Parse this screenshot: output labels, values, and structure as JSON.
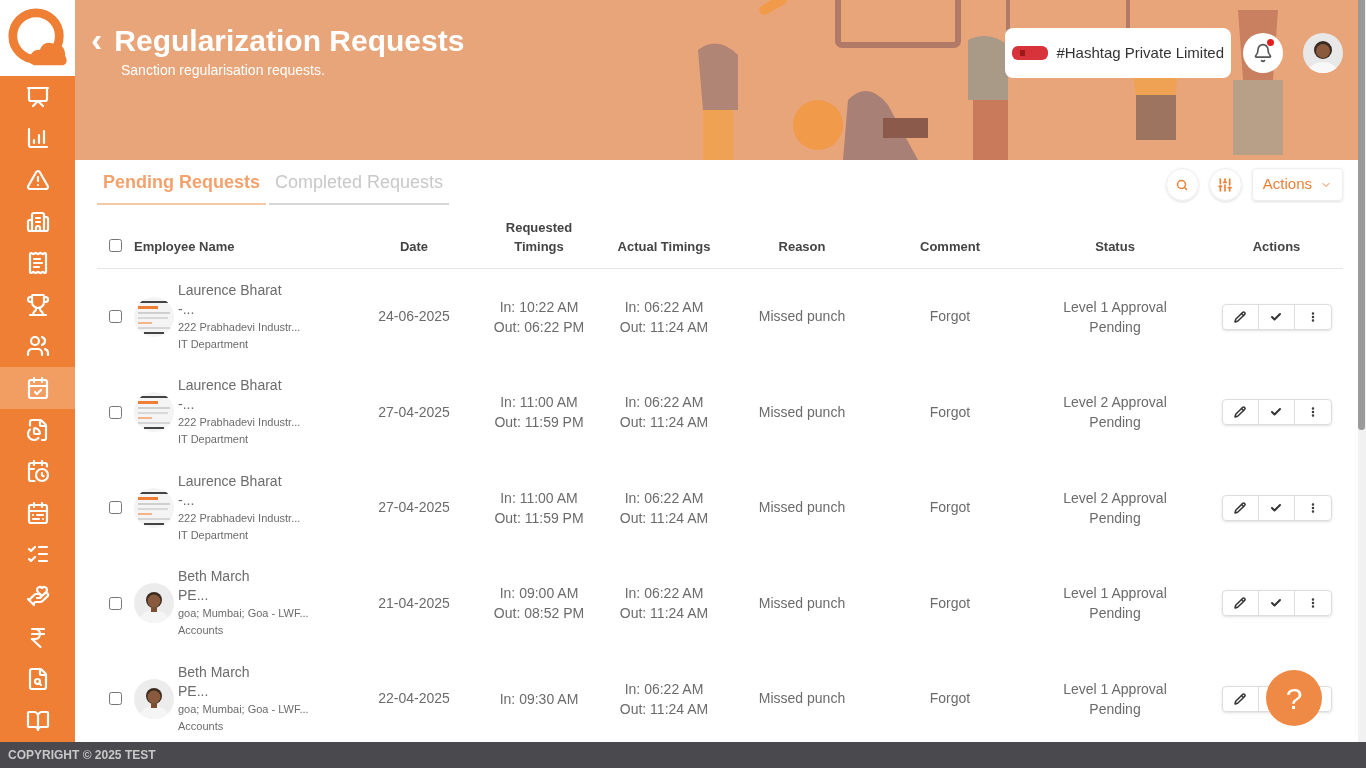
{
  "sidebar": {
    "items": [
      {
        "selected": false
      },
      {
        "selected": false
      },
      {
        "selected": false
      },
      {
        "selected": false
      },
      {
        "selected": false
      },
      {
        "selected": false
      },
      {
        "selected": false
      },
      {
        "selected": true
      },
      {
        "selected": false
      },
      {
        "selected": false
      },
      {
        "selected": false
      },
      {
        "selected": false
      },
      {
        "selected": false
      },
      {
        "selected": false
      },
      {
        "selected": false
      },
      {
        "selected": false
      }
    ]
  },
  "header": {
    "back": "‹",
    "title": "Regularization Requests",
    "subtitle": "Sanction regularisation requests.",
    "company": "#Hashtag Private Limited",
    "notifications": {
      "unread": true
    }
  },
  "tabs": [
    {
      "label": "Pending Requests",
      "selected": true
    },
    {
      "label": "Completed Requests",
      "selected": false
    }
  ],
  "toolbar": {
    "actions_button": "Actions"
  },
  "table": {
    "select_all": {
      "checked": false
    },
    "columns": [
      "Employee Name",
      "Date",
      "Requested Timings",
      "Actual Timings",
      "Reason",
      "Comment",
      "Status",
      "Actions"
    ],
    "rows": [
      {
        "checked": false,
        "avatar": {
          "kind": "document"
        },
        "name": "Laurence Bharat",
        "name_rest": "-...",
        "location": "222 Prabhadevi Industr...",
        "department": "IT Department",
        "date": "24-06-2025",
        "requested": [
          "In: 10:22 AM",
          "Out: 06:22 PM"
        ],
        "actual": [
          "In: 06:22 AM",
          "Out: 11:24 AM"
        ],
        "reason": "Missed punch",
        "comment": "Forgot",
        "status": "Level 1 Approval Pending"
      },
      {
        "checked": false,
        "avatar": {
          "kind": "document"
        },
        "name": "Laurence Bharat",
        "name_rest": "-...",
        "location": "222 Prabhadevi Industr...",
        "department": "IT Department",
        "date": "27-04-2025",
        "requested": [
          "In: 11:00 AM",
          "Out: 11:59 PM"
        ],
        "actual": [
          "In: 06:22 AM",
          "Out: 11:24 AM"
        ],
        "reason": "Missed punch",
        "comment": "Forgot",
        "status": "Level 2 Approval Pending"
      },
      {
        "checked": false,
        "avatar": {
          "kind": "document"
        },
        "name": "Laurence Bharat",
        "name_rest": "-...",
        "location": "222 Prabhadevi Industr...",
        "department": "IT Department",
        "date": "27-04-2025",
        "requested": [
          "In: 11:00 AM",
          "Out: 11:59 PM"
        ],
        "actual": [
          "In: 06:22 AM",
          "Out: 11:24 AM"
        ],
        "reason": "Missed punch",
        "comment": "Forgot",
        "status": "Level 2 Approval Pending"
      },
      {
        "checked": false,
        "avatar": {
          "kind": "person"
        },
        "name": "Beth March",
        "name_rest": "PE...",
        "location": "goa; Mumbai; Goa - LWF...",
        "department": "Accounts",
        "date": "21-04-2025",
        "requested": [
          "In: 09:00 AM",
          "Out: 08:52 PM"
        ],
        "actual": [
          "In: 06:22 AM",
          "Out: 11:24 AM"
        ],
        "reason": "Missed punch",
        "comment": "Forgot",
        "status": "Level 1 Approval Pending"
      },
      {
        "checked": false,
        "avatar": {
          "kind": "person"
        },
        "name": "Beth March",
        "name_rest": "PE...",
        "location": "goa; Mumbai; Goa - LWF...",
        "department": "Accounts",
        "date": "22-04-2025",
        "requested": [
          "In: 09:30 AM"
        ],
        "actual": [
          "In: 06:22 AM",
          "Out: 11:24 AM"
        ],
        "reason": "Missed punch",
        "comment": "Forgot",
        "status": "Level 1 Approval Pending"
      }
    ]
  },
  "help_button": "?",
  "footer": "COPYRIGHT © 2025 TEST"
}
